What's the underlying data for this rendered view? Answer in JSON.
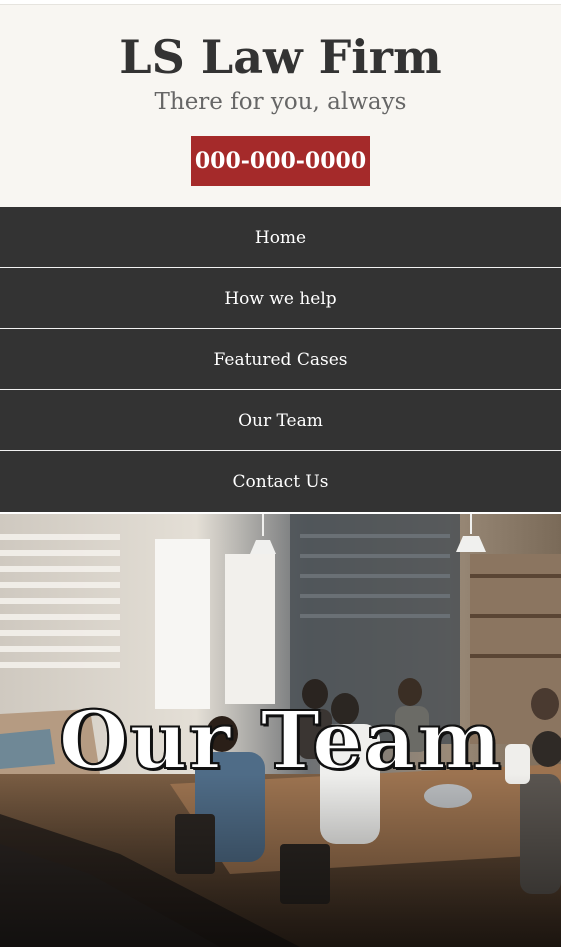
{
  "header": {
    "title": "LS Law Firm",
    "tagline": "There for you, always",
    "phone": "000-000-0000"
  },
  "nav": {
    "items": [
      {
        "label": "Home"
      },
      {
        "label": "How we help"
      },
      {
        "label": "Featured Cases"
      },
      {
        "label": "Our Team"
      },
      {
        "label": "Contact Us"
      }
    ]
  },
  "hero": {
    "title": "Our Team",
    "image": "team-meeting-photo"
  },
  "colors": {
    "header_bg": "#f8f6f2",
    "title": "#333333",
    "tagline": "#666666",
    "phone_button": "#a52a2a",
    "nav_bg": "#333333",
    "nav_text": "#ffffff"
  }
}
